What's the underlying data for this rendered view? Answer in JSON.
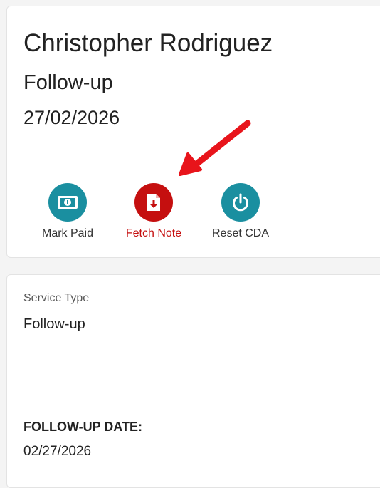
{
  "header": {
    "patient_name": "Christopher Rodriguez",
    "visit_type": "Follow-up",
    "visit_date": "27/02/2026"
  },
  "actions": [
    {
      "label": "Mark Paid",
      "icon": "cash-icon",
      "color": "#1a8fa0"
    },
    {
      "label": "Fetch Note",
      "icon": "file-download-icon",
      "color": "#c50f0f"
    },
    {
      "label": "Reset CDA",
      "icon": "power-icon",
      "color": "#1a8fa0"
    }
  ],
  "details": {
    "service_type_label": "Service Type",
    "service_type_value": "Follow-up",
    "followup_date_label": "FOLLOW-UP DATE:",
    "followup_date_value": "02/27/2026"
  },
  "annotation": {
    "arrow_color": "#e8141b"
  }
}
